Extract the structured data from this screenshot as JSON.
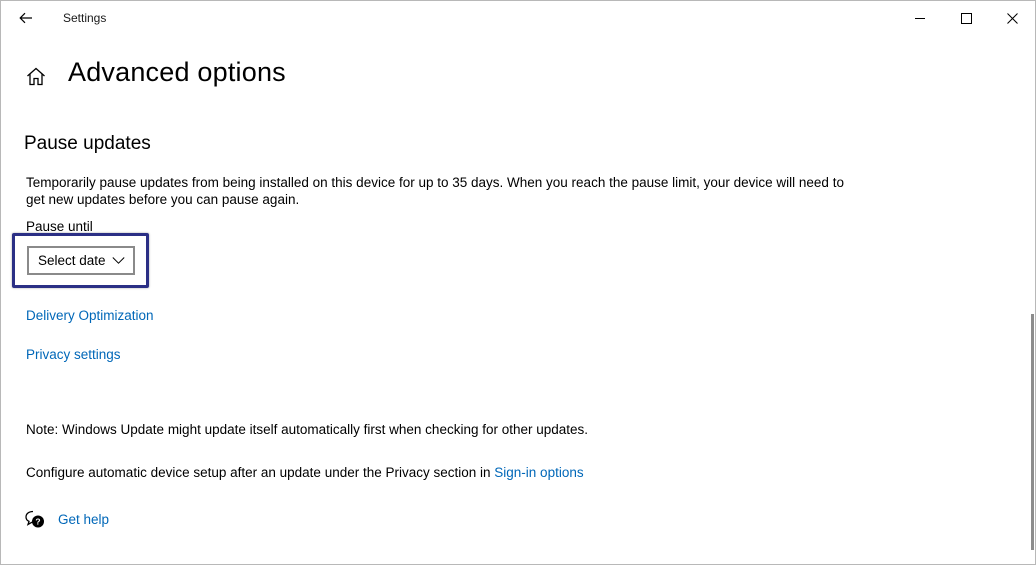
{
  "window": {
    "title": "Settings",
    "icons": {
      "back": "back-arrow-icon",
      "minimize": "minimize-icon",
      "maximize": "maximize-icon",
      "close": "close-icon"
    }
  },
  "header": {
    "home_icon": "home-icon",
    "title": "Advanced options"
  },
  "pause_updates": {
    "heading": "Pause updates",
    "description": "Temporarily pause updates from being installed on this device for up to 35 days. When you reach the pause limit, your device will need to get new updates before you can pause again.",
    "label": "Pause until",
    "select_value": "Select date"
  },
  "links": {
    "delivery": "Delivery Optimization",
    "privacy": "Privacy settings"
  },
  "note": "Note: Windows Update might update itself automatically first when checking for other updates.",
  "configure": {
    "text": "Configure automatic device setup after an update under the Privacy section in ",
    "link": "Sign-in options"
  },
  "help": {
    "icon": "help-chat-icon",
    "label": "Get help"
  },
  "colors": {
    "link": "#0067b8",
    "highlight": "#2b2f85",
    "select_border": "#8a8a8a"
  }
}
